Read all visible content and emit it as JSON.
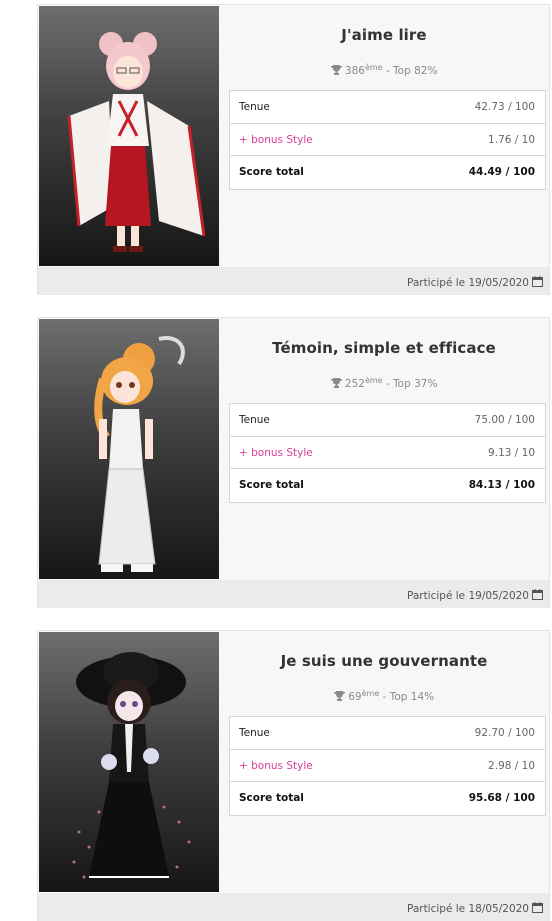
{
  "entries": [
    {
      "title": "J'aime lire",
      "rank": "386",
      "rank_suffix": "ème",
      "top": " - Top 82%",
      "outfit_label": "Tenue",
      "outfit_value": "42.73 / 100",
      "bonus_label": "+ bonus Style",
      "bonus_value": "1.76 / 10",
      "total_label": "Score total",
      "total_value": "44.49 / 100",
      "participated": "Participé le 19/05/2020"
    },
    {
      "title": "Témoin, simple et efficace",
      "rank": "252",
      "rank_suffix": "ème",
      "top": " - Top 37%",
      "outfit_label": "Tenue",
      "outfit_value": "75.00 / 100",
      "bonus_label": "+ bonus Style",
      "bonus_value": "9.13 / 10",
      "total_label": "Score total",
      "total_value": "84.13 / 100",
      "participated": "Participé le 19/05/2020"
    },
    {
      "title": "Je suis une gouvernante",
      "rank": "69",
      "rank_suffix": "ème",
      "top": " - Top 14%",
      "outfit_label": "Tenue",
      "outfit_value": "92.70 / 100",
      "bonus_label": "+ bonus Style",
      "bonus_value": "2.98 / 10",
      "total_label": "Score total",
      "total_value": "95.68 / 100",
      "participated": "Participé le 18/05/2020"
    }
  ],
  "icons": {
    "rank": "trophy-icon",
    "date": "calendar-icon"
  }
}
